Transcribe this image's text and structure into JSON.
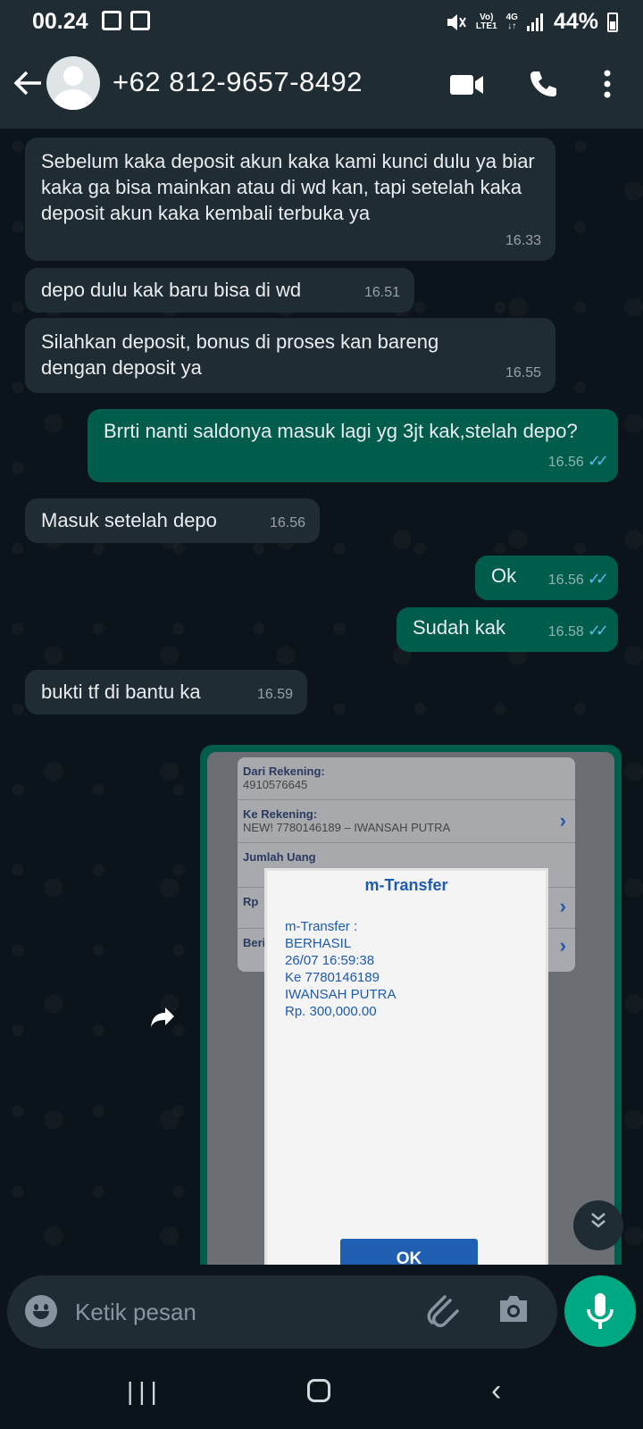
{
  "status_bar": {
    "time": "00.24",
    "network_label_top": "Vo)",
    "network_label_bottom": "LTE1",
    "signal_type": "4G",
    "battery": "44%"
  },
  "header": {
    "contact_name": "+62 812-9657-8492",
    "icons": [
      "back-arrow-icon",
      "avatar",
      "video-call-icon",
      "voice-call-icon",
      "more-options-icon"
    ]
  },
  "messages": [
    {
      "direction": "in",
      "text": "Sebelum kaka deposit akun kaka kami kunci dulu ya biar kaka ga bisa mainkan atau di wd kan, tapi setelah kaka deposit akun kaka kembali terbuka ya",
      "time": "16.33"
    },
    {
      "direction": "in",
      "text": "depo dulu kak baru bisa di wd",
      "time": "16.51"
    },
    {
      "direction": "in",
      "text": "Silahkan deposit, bonus di proses kan bareng dengan deposit ya",
      "time": "16.55"
    },
    {
      "direction": "out",
      "text": "Brrti nanti saldonya masuk lagi yg 3jt kak,stelah depo?",
      "time": "16.56"
    },
    {
      "direction": "in",
      "text": "Masuk setelah depo",
      "time": "16.56"
    },
    {
      "direction": "out",
      "text": "Ok",
      "time": "16.56"
    },
    {
      "direction": "out",
      "text": "Sudah kak",
      "time": "16.58"
    },
    {
      "direction": "in",
      "text": "bukti tf di bantu ka",
      "time": "16.59"
    }
  ],
  "image_message": {
    "card": {
      "from_label": "Dari Rekening:",
      "from_value": "4910576645",
      "to_label": "Ke Rekening:",
      "to_value": "NEW! 7780146189 – IWANSAH PUTRA",
      "amount_label": "Jumlah Uang",
      "rp_label": "Rp",
      "beri_label": "Beri"
    },
    "dialog": {
      "title": "m-Transfer",
      "line1": "m-Transfer :",
      "line2": "BERHASIL",
      "line3": "26/07 16:59:38",
      "line4": "Ke 7780146189",
      "line5": "IWANSAH PUTRA",
      "line6": "Rp. 300,000.00",
      "button": "OK"
    }
  },
  "input": {
    "placeholder": "Ketik pesan"
  },
  "colors": {
    "background": "#0b141a",
    "incoming_bubble": "#1f2c34",
    "outgoing_bubble": "#005c4b",
    "accent": "#00a884",
    "read_ticks": "#53bdeb"
  }
}
